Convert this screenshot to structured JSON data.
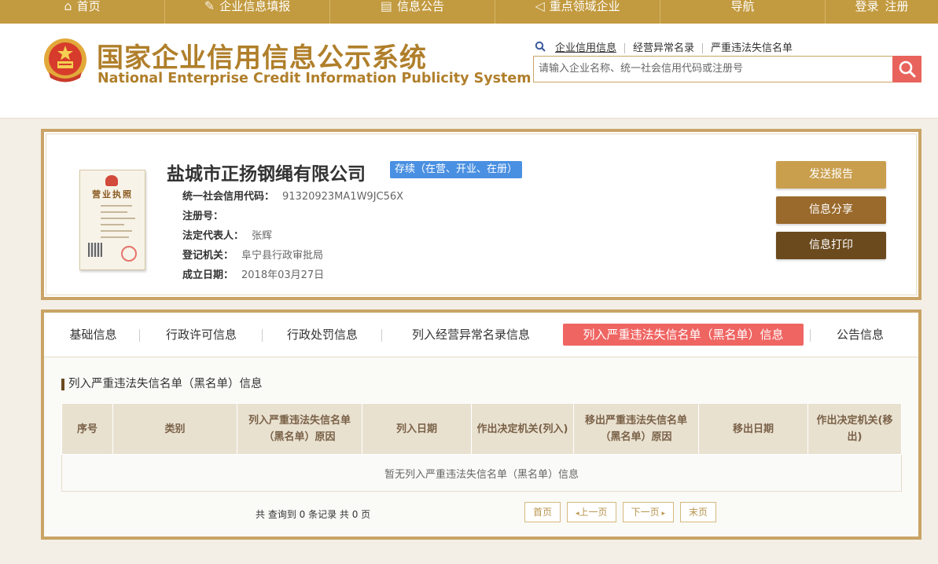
{
  "topnav": {
    "items": [
      {
        "label": "首页",
        "icon": "home-icon"
      },
      {
        "label": "企业信息填报",
        "icon": "edit-icon"
      },
      {
        "label": "信息公告",
        "icon": "document-icon"
      },
      {
        "label": "重点领域企业",
        "icon": "megaphone-icon"
      },
      {
        "label": "导航",
        "icon": ""
      }
    ],
    "login": "登录",
    "register": "注册"
  },
  "header": {
    "title_zh": "国家企业信用信息公示系统",
    "title_en": "National Enterprise Credit Information Publicity System",
    "search_links": [
      "企业信用信息",
      "经营异常名录",
      "严重违法失信名单"
    ],
    "search_placeholder": "请输入企业名称、统一社会信用代码或注册号"
  },
  "company": {
    "license_title": "营业执照",
    "name": "盐城市正扬钢绳有限公司",
    "status": "存续（在营、开业、在册）",
    "fields": [
      {
        "label": "统一社会信用代码：",
        "value": "91320923MA1W9JC56X"
      },
      {
        "label": "注册号：",
        "value": ""
      },
      {
        "label": "法定代表人：",
        "value": "张辉"
      },
      {
        "label": "登记机关：",
        "value": "阜宁县行政审批局"
      },
      {
        "label": "成立日期：",
        "value": "2018年03月27日"
      }
    ],
    "buttons": [
      {
        "label": "发送报告",
        "color": "#c99f4e"
      },
      {
        "label": "信息分享",
        "color": "#9a6a2c"
      },
      {
        "label": "信息打印",
        "color": "#6b4a1e"
      }
    ]
  },
  "tabs": [
    "基础信息",
    "行政许可信息",
    "行政处罚信息",
    "列入经营异常名录信息",
    "列入严重违法失信名单（黑名单）信息",
    "公告信息"
  ],
  "active_tab": 4,
  "section": {
    "title": "列入严重违法失信名单（黑名单）信息",
    "columns": [
      "序号",
      "类别",
      "列入严重违法失信名单（黑名单）原因",
      "列入日期",
      "作出决定机关(列入)",
      "移出严重违法失信名单（黑名单）原因",
      "移出日期",
      "作出决定机关(移出)"
    ],
    "empty_text": "暂无列入严重违法失信名单（黑名单）信息",
    "record_count": "共 查询到 0 条记录 共 0 页"
  },
  "pager": {
    "first": "首页",
    "prev": "上一页",
    "next": "下一页",
    "last": "末页"
  }
}
